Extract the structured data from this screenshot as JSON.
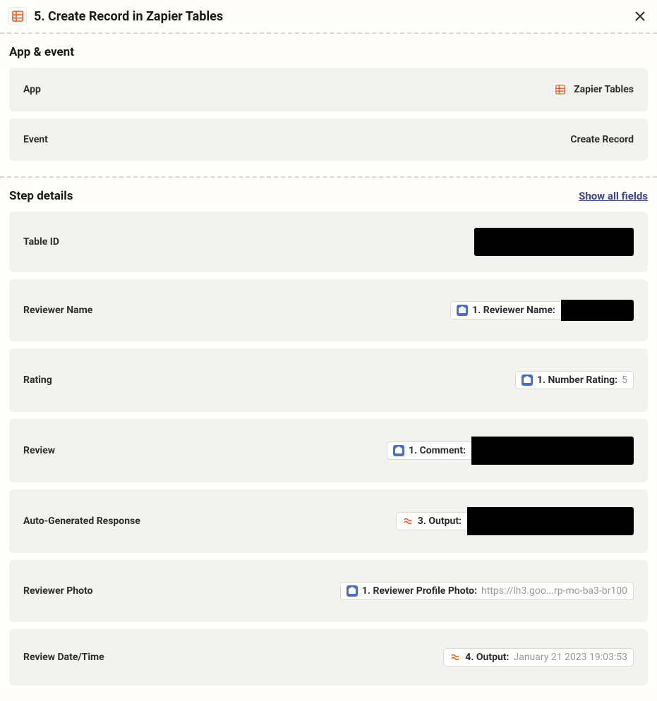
{
  "header": {
    "title": "5. Create Record in Zapier Tables"
  },
  "app_event": {
    "section_title": "App & event",
    "app_label": "App",
    "app_value": "Zapier Tables",
    "event_label": "Event",
    "event_value": "Create Record"
  },
  "step_details": {
    "section_title": "Step details",
    "show_all": "Show all fields",
    "fields": {
      "table_id": {
        "label": "Table ID"
      },
      "reviewer_name": {
        "label": "Reviewer Name",
        "pill_label": "1. Reviewer Name:"
      },
      "rating": {
        "label": "Rating",
        "pill_label": "1. Number Rating:",
        "pill_value": "5"
      },
      "review": {
        "label": "Review",
        "pill_label": "1. Comment:"
      },
      "auto_response": {
        "label": "Auto-Generated Response",
        "pill_label": "3. Output:"
      },
      "reviewer_photo": {
        "label": "Reviewer Photo",
        "pill_label": "1. Reviewer Profile Photo:",
        "pill_value": "https://lh3.goo...rp-mo-ba3-br100"
      },
      "review_datetime": {
        "label": "Review Date/Time",
        "pill_label": "4. Output:",
        "pill_value": "January 21 2023 19:03:53"
      }
    }
  }
}
